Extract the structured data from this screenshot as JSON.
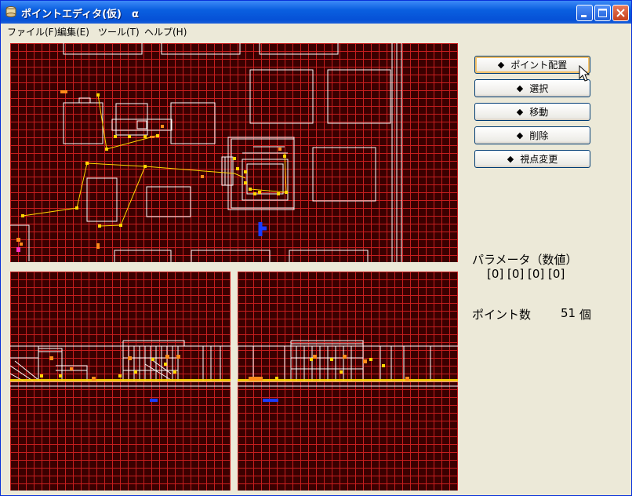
{
  "window": {
    "title": "ポイントエディタ(仮)　α"
  },
  "menu": [
    "ファイル(F)",
    "編集(E)",
    "ツール(T)",
    "ヘルプ(H)"
  ],
  "buttons": [
    {
      "label": "ポイント配置",
      "icon": "diamond-icon"
    },
    {
      "label": "選択",
      "icon": "diamond-icon"
    },
    {
      "label": "移動",
      "icon": "diamond-icon"
    },
    {
      "label": "削除",
      "icon": "diamond-icon"
    },
    {
      "label": "視点変更",
      "icon": "diamond-icon"
    }
  ],
  "params": {
    "label": "パラメータ（数値）",
    "values": "[0] [0] [0] [0]"
  },
  "points": {
    "label": "ポイント数",
    "count": "51",
    "unit": "個"
  },
  "colors": {
    "viewport_bg": "#3a0000",
    "grid": "#c81e1e",
    "points": "#ffd700",
    "marker": "#ff8c1a",
    "camera": "#1a3cff",
    "titlebar": "#0a5fe0"
  }
}
